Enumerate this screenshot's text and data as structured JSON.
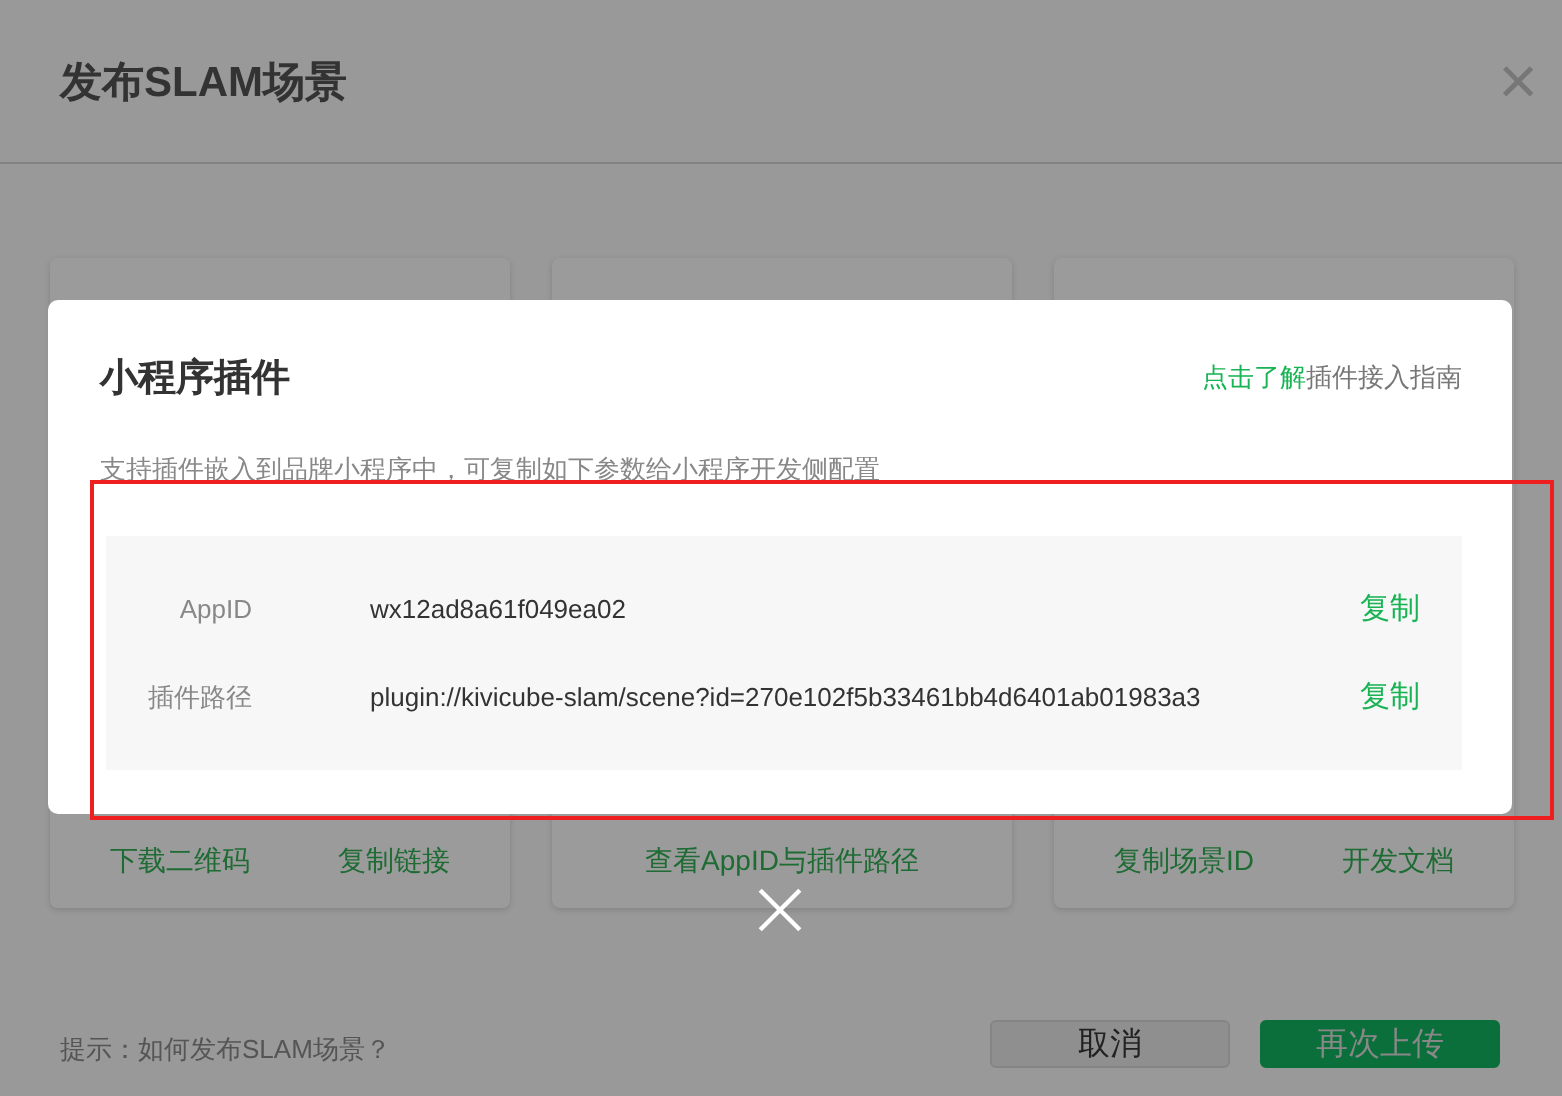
{
  "page": {
    "title": "发布SLAM场景",
    "close": "×"
  },
  "cards": [
    {
      "actions": [
        "下载二维码",
        "复制链接"
      ]
    },
    {
      "actions": [
        "查看AppID与插件路径"
      ]
    },
    {
      "actions": [
        "复制场景ID",
        "开发文档"
      ]
    }
  ],
  "modal": {
    "title": "小程序插件",
    "guide_link": {
      "highlight": "点击了解",
      "rest": "插件接入指南"
    },
    "description": "支持插件嵌入到品牌小程序中，可复制如下参数给小程序开发侧配置",
    "params": [
      {
        "label": "AppID",
        "value": "wx12ad8a61f049ea02",
        "action": "复制"
      },
      {
        "label": "插件路径",
        "value": "plugin://kivicube-slam/scene?id=270e102f5b33461bb4d6401ab01983a3",
        "action": "复制"
      }
    ]
  },
  "footer": {
    "hint": "提示：如何发布SLAM场景？",
    "buttons": [
      {
        "label": "取消",
        "kind": "secondary"
      },
      {
        "label": "再次上传",
        "kind": "primary"
      }
    ]
  }
}
